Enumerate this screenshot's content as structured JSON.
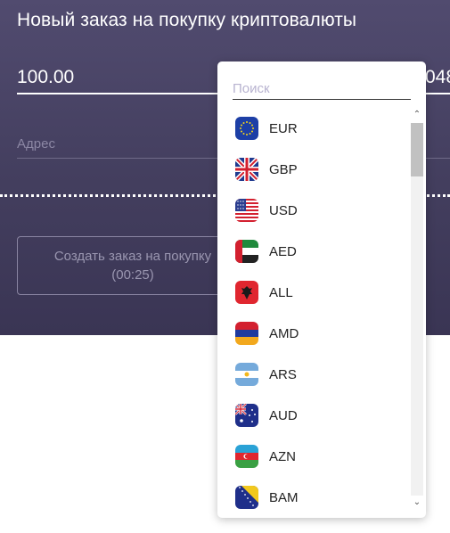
{
  "form": {
    "title": "Новый заказ на покупку криптовалюты",
    "amount_value": "100.00",
    "right_value": "048",
    "address_placeholder": "Адрес",
    "create_button_line1": "Создать заказ на покупку",
    "create_button_line2": "(00:25)"
  },
  "dropdown": {
    "search_placeholder": "Поиск",
    "currencies": [
      {
        "code": "EUR",
        "flag": "eu-flag-icon"
      },
      {
        "code": "GBP",
        "flag": "uk-flag-icon"
      },
      {
        "code": "USD",
        "flag": "us-flag-icon"
      },
      {
        "code": "AED",
        "flag": "uae-flag-icon"
      },
      {
        "code": "ALL",
        "flag": "albania-flag-icon"
      },
      {
        "code": "AMD",
        "flag": "armenia-flag-icon"
      },
      {
        "code": "ARS",
        "flag": "argentina-flag-icon"
      },
      {
        "code": "AUD",
        "flag": "australia-flag-icon"
      },
      {
        "code": "AZN",
        "flag": "azerbaijan-flag-icon"
      },
      {
        "code": "BAM",
        "flag": "bosnia-flag-icon"
      }
    ],
    "scroll_up_glyph": "⌃",
    "scroll_down_glyph": "⌄"
  },
  "colors": {
    "panel": "#474262",
    "dropdown_bg": "#ffffff",
    "placeholder": "#b8b3d0"
  }
}
